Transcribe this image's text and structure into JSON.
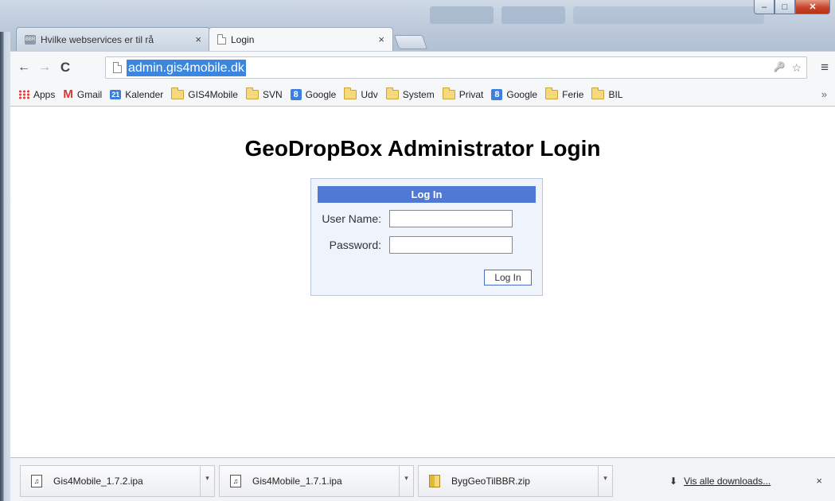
{
  "window": {
    "minimize_symbol": "–",
    "maximize_symbol": "□",
    "close_symbol": "✕"
  },
  "tabs": [
    {
      "title": "Hvilke webservices er til rå",
      "favicon": "bbr-favicon",
      "close": "×"
    },
    {
      "title": "Login",
      "favicon": "page-icon",
      "close": "×",
      "active": true
    }
  ],
  "toolbar": {
    "back": "←",
    "forward": "→",
    "reload": "C",
    "url": "admin.gis4mobile.dk",
    "key_symbol": "🔑",
    "star_symbol": "☆",
    "menu_symbol": "≡"
  },
  "bookmarks": {
    "items": [
      {
        "label": "Apps",
        "icon": "apps-icon"
      },
      {
        "label": "Gmail",
        "icon": "gmail-icon",
        "glyph": "M"
      },
      {
        "label": "Kalender",
        "icon": "calendar-icon",
        "glyph": "21"
      },
      {
        "label": "GIS4Mobile",
        "icon": "folder-icon"
      },
      {
        "label": "SVN",
        "icon": "folder-icon"
      },
      {
        "label": "Google",
        "icon": "google-icon",
        "glyph": "8"
      },
      {
        "label": "Udv",
        "icon": "folder-icon"
      },
      {
        "label": "System",
        "icon": "folder-icon"
      },
      {
        "label": "Privat",
        "icon": "folder-icon"
      },
      {
        "label": "Google",
        "icon": "google-icon",
        "glyph": "8"
      },
      {
        "label": "Ferie",
        "icon": "folder-icon"
      },
      {
        "label": "BIL",
        "icon": "folder-icon"
      }
    ],
    "more": "»"
  },
  "page": {
    "title": "GeoDropBox Administrator Login",
    "login": {
      "header": "Log In",
      "username_label": "User Name:",
      "username_value": "",
      "password_label": "Password:",
      "password_value": "",
      "button": "Log In"
    }
  },
  "downloads": {
    "items": [
      {
        "name": "Gis4Mobile_1.7.2.ipa",
        "icon": "ipa-file-icon",
        "glyph": "♫"
      },
      {
        "name": "Gis4Mobile_1.7.1.ipa",
        "icon": "ipa-file-icon",
        "glyph": "♫"
      },
      {
        "name": "BygGeoTilBBR.zip",
        "icon": "zip-file-icon"
      }
    ],
    "caret": "▾",
    "show_all": "Vis alle downloads...",
    "show_all_arrow": "⬇",
    "close": "×"
  },
  "colors": {
    "accent": "#5079d5",
    "url_highlight": "#3b86df",
    "close_button": "#c6442b"
  }
}
